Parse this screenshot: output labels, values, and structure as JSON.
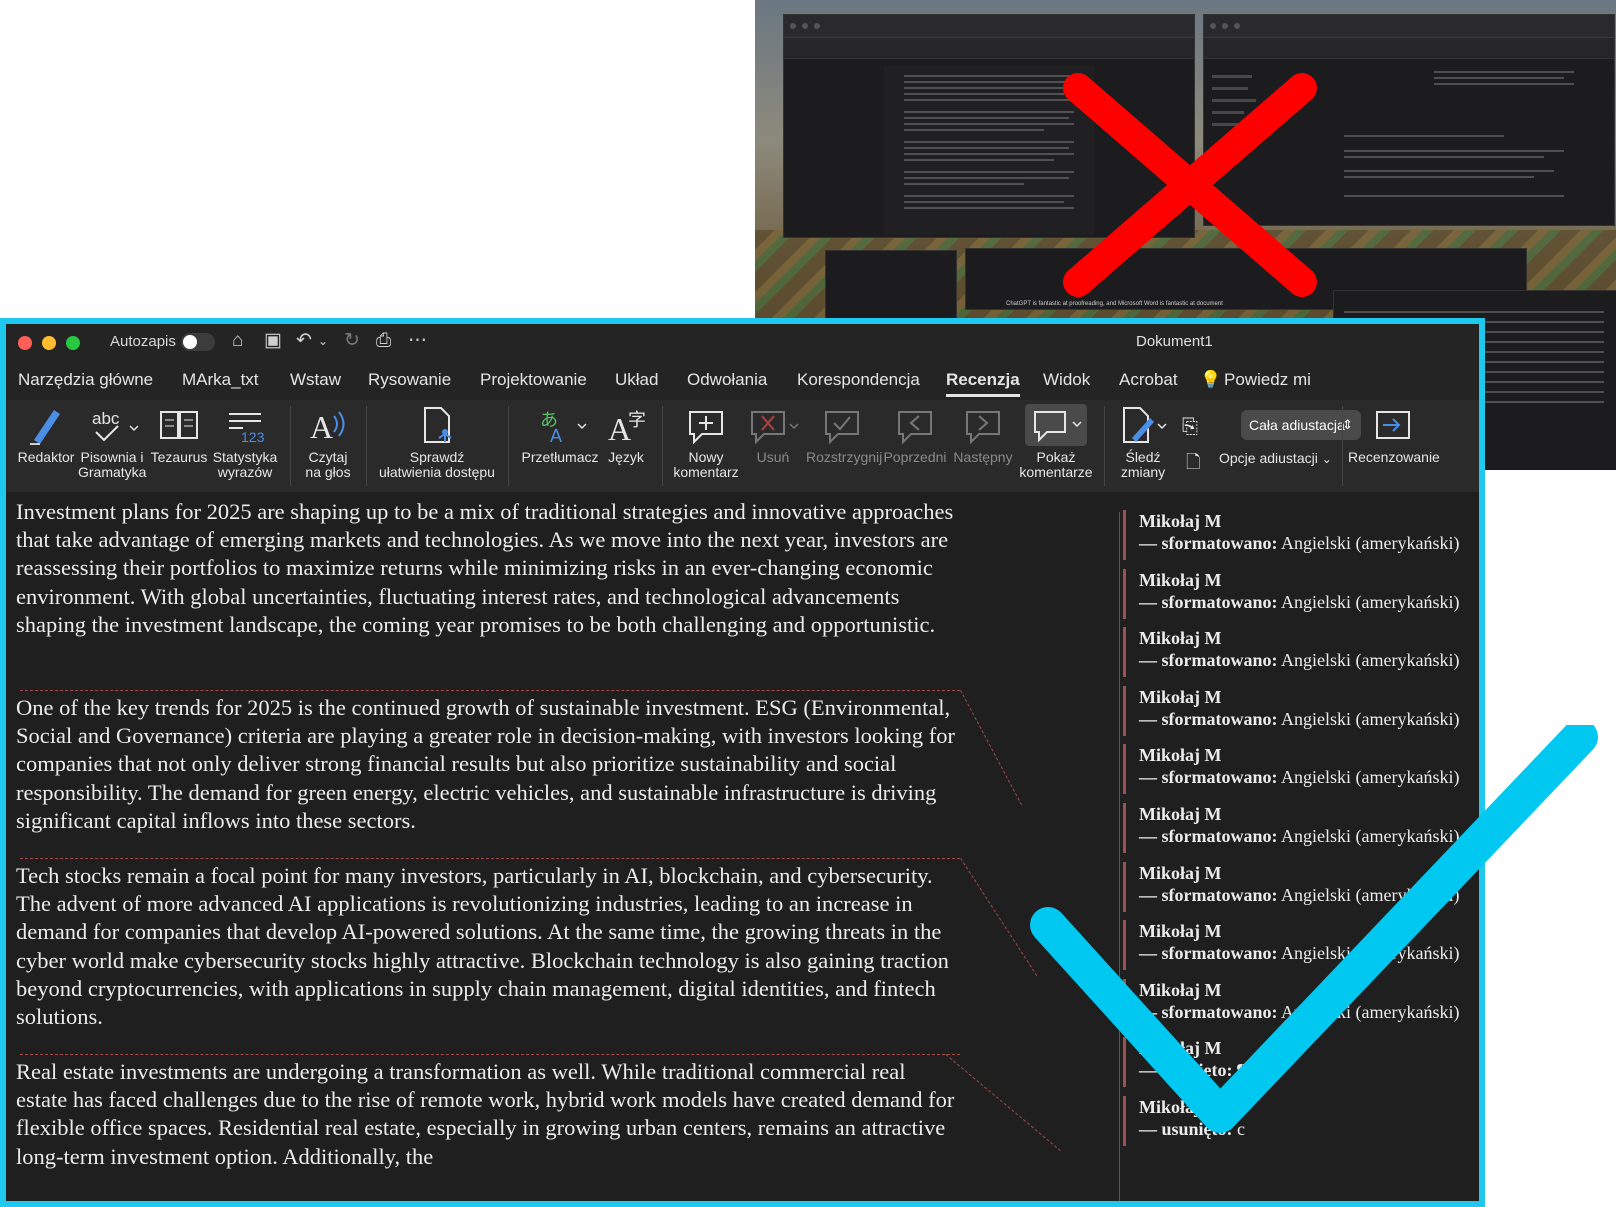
{
  "background_window": {
    "status_caption": "ChatGPT is fantastic at proofreading, and Microsoft Word is fantastic at document"
  },
  "titlebar": {
    "autosave_label": "Autozapis",
    "document_title": "Dokument1"
  },
  "tabs": [
    {
      "label": "Narzędzia główne"
    },
    {
      "label": "MArka_txt"
    },
    {
      "label": "Wstaw"
    },
    {
      "label": "Rysowanie"
    },
    {
      "label": "Projektowanie"
    },
    {
      "label": "Układ"
    },
    {
      "label": "Odwołania"
    },
    {
      "label": "Korespondencja"
    },
    {
      "label": "Recenzja"
    },
    {
      "label": "Widok"
    },
    {
      "label": "Acrobat"
    },
    {
      "label": "Powiedz mi"
    }
  ],
  "ribbon": {
    "editor": "Redaktor",
    "spelling_line1": "Pisownia i",
    "spelling_line2": "Gramatyka",
    "thesaurus": "Tezaurus",
    "wordcount_line1": "Statystyka",
    "wordcount_line2": "wyrazów",
    "readaloud_line1": "Czytaj",
    "readaloud_line2": "na głos",
    "access_line1": "Sprawdź",
    "access_line2": "ułatwienia dostępu",
    "translate": "Przetłumacz",
    "language": "Język",
    "newcomment_line1": "Nowy",
    "newcomment_line2": "komentarz",
    "delete": "Usuń",
    "resolve": "Rozstrzygnij",
    "previous": "Poprzedni",
    "next": "Następny",
    "show_line1": "Pokaż",
    "show_line2": "komentarze",
    "track_line1": "Śledź",
    "track_line2": "zmiany",
    "markup_select": "Cała adiustacja",
    "markup_options": "Opcje adiustacji",
    "reviewing": "Recenzowanie"
  },
  "document": {
    "paragraphs": [
      "Investment plans for 2025 are shaping up to be a mix of traditional strategies and innovative approaches that take advantage of emerging markets and technologies. As we move into the next year, investors are reassessing their portfolios to maximize returns while minimizing risks in an ever-changing economic environment. With global uncertainties, fluctuating interest rates, and technological advancements shaping the investment landscape, the coming year promises to be both challenging and opportunistic.",
      "One of the key trends for 2025 is the continued growth of sustainable investment. ESG (Environmental, Social and Governance) criteria are playing a greater role in decision-making, with investors looking for companies that not only deliver strong financial results but also prioritize sustainability and social responsibility. The demand for green energy, electric vehicles, and sustainable infrastructure is driving significant capital inflows into these sectors.",
      "Tech stocks remain a focal point for many investors, particularly in AI, blockchain, and cybersecurity. The advent of more advanced AI applications is revolutionizing industries, leading to an increase in demand for companies that develop AI-powered solutions. At the same time, the growing threats in the cyber world make cybersecurity stocks highly attractive. Blockchain technology is also gaining traction beyond cryptocurrencies, with applications in supply chain management, digital identities, and fintech solutions.",
      "Real estate investments are undergoing a transformation as well. While traditional commercial real estate has faced challenges due to the rise of remote work, hybrid work models have created demand for flexible office spaces. Residential real estate, especially in growing urban centers, remains an attractive long-term investment option. Additionally, the"
    ]
  },
  "comments": [
    {
      "author": "Mikołaj M",
      "action": "— sformatowano:",
      "detail": "Angielski (amerykański)"
    },
    {
      "author": "Mikołaj M",
      "action": "— sformatowano:",
      "detail": "Angielski (amerykański)"
    },
    {
      "author": "Mikołaj M",
      "action": "— sformatowano:",
      "detail": "Angielski (amerykański)"
    },
    {
      "author": "Mikołaj M",
      "action": "— sformatowano:",
      "detail": "Angielski (amerykański)"
    },
    {
      "author": "Mikołaj M",
      "action": "— sformatowano:",
      "detail": "Angielski (amerykański)"
    },
    {
      "author": "Mikołaj M",
      "action": "— sformatowano:",
      "detail": "Angielski (amerykański)"
    },
    {
      "author": "Mikołaj M",
      "action": "— sformatowano:",
      "detail": "Angielski (amerykański)"
    },
    {
      "author": "Mikołaj M",
      "action": "— sformatowano:",
      "detail": "Angielski (amerykański)"
    },
    {
      "author": "Mikołaj M",
      "action": "— sformatowano:",
      "detail": "Angielski (amerykański)"
    },
    {
      "author": "Mikołaj M",
      "action": "— usunięto:",
      "detail": "¶"
    },
    {
      "author": "Mikołaj M",
      "action": "— usunięto:",
      "detail": "c"
    }
  ],
  "colors": {
    "frame_accent": "#1fc8ef",
    "x_mark": "#ff0000",
    "check_mark": "#00c8f0",
    "revision_mark": "#e05858"
  },
  "icons": [
    "close-dot",
    "minimize-dot",
    "zoom-dot",
    "home-icon",
    "save-icon",
    "undo-icon",
    "redo-icon",
    "print-icon",
    "more-icon",
    "lightbulb-icon"
  ]
}
